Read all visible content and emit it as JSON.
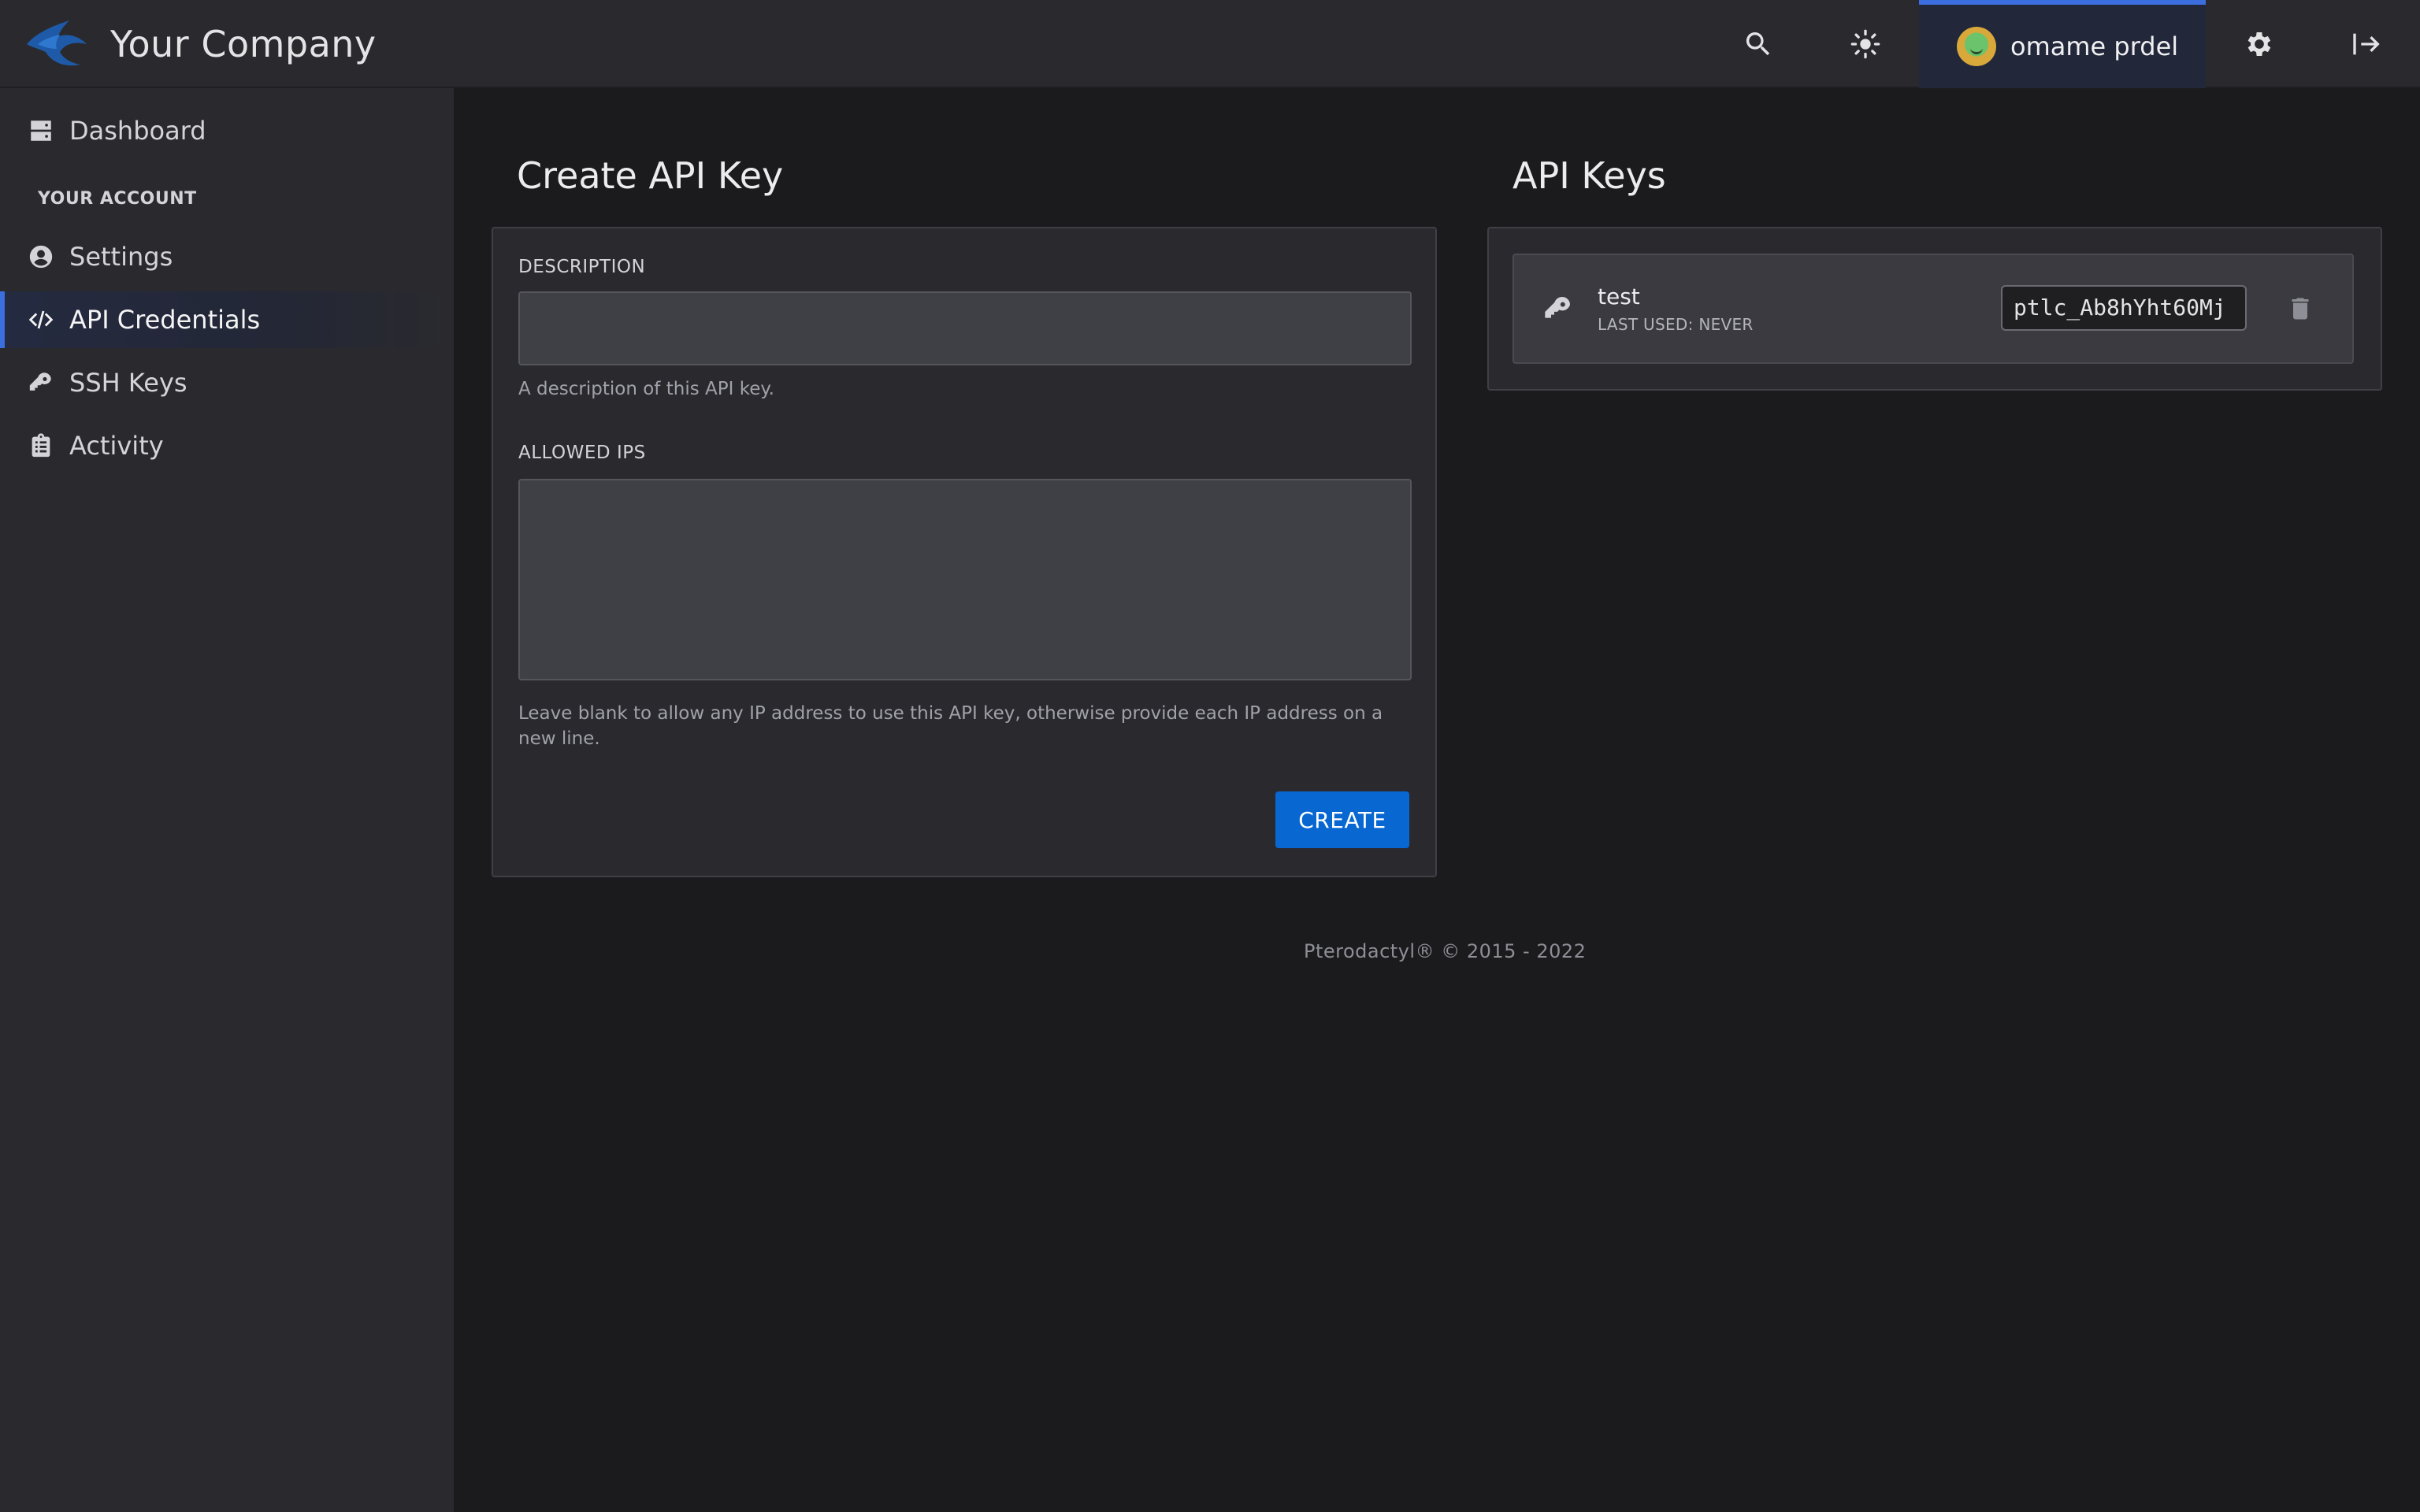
{
  "header": {
    "brand": "Your Company",
    "icons": [
      "search-icon",
      "theme-toggle-icon",
      "gear-icon",
      "logout-icon"
    ],
    "user": {
      "name": "omame prdel"
    },
    "accent": "#3b6fe0"
  },
  "sidebar": {
    "items": [
      {
        "label": "Dashboard",
        "icon": "server-icon"
      },
      {
        "label": "Settings",
        "icon": "user-circle-icon"
      },
      {
        "label": "API Credentials",
        "icon": "code-icon",
        "active": true
      },
      {
        "label": "SSH Keys",
        "icon": "key-icon"
      },
      {
        "label": "Activity",
        "icon": "clipboard-icon"
      }
    ],
    "section_label": "YOUR ACCOUNT"
  },
  "create_key": {
    "title": "Create API Key",
    "description_label": "DESCRIPTION",
    "description_value": "",
    "description_help": "A description of this API key.",
    "allowed_ips_label": "ALLOWED IPS",
    "allowed_ips_value": "",
    "allowed_ips_help": "Leave blank to allow any IP address to use this API key, otherwise provide each IP address on a new line.",
    "create_label": "CREATE",
    "button_color": "#0967d2"
  },
  "api_keys": {
    "title": "API Keys",
    "keys": [
      {
        "name": "test",
        "last_used": "LAST USED: NEVER",
        "token": "ptlc_Ab8hYht60Mj"
      }
    ]
  },
  "footer": {
    "text": "Pterodactyl® © 2015 - 2022"
  }
}
